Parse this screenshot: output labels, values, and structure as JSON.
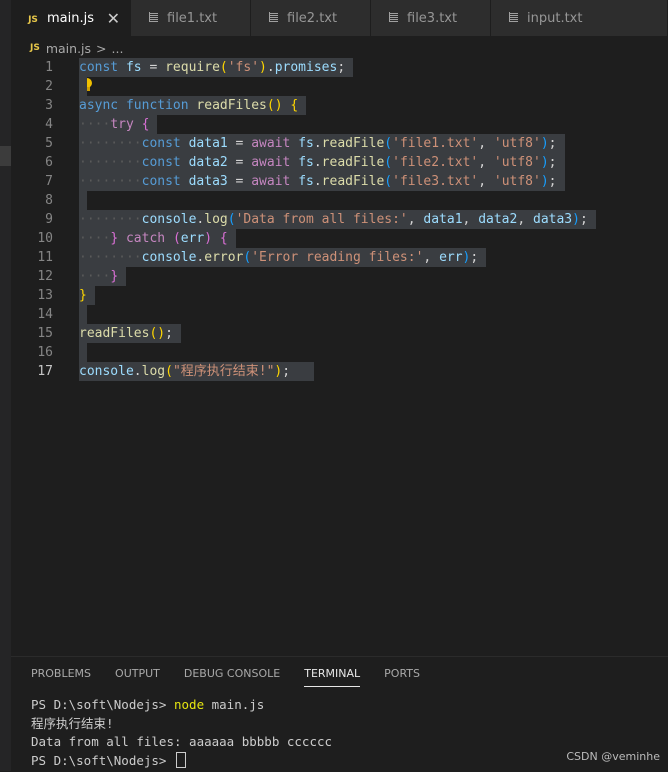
{
  "tabs": [
    {
      "label": "main.js",
      "icon": "js-icon",
      "active": true,
      "close": "✕"
    },
    {
      "label": "file1.txt",
      "icon": "file-lines-icon"
    },
    {
      "label": "file2.txt",
      "icon": "file-lines-icon"
    },
    {
      "label": "file3.txt",
      "icon": "file-lines-icon"
    },
    {
      "label": "input.txt",
      "icon": "file-lines-icon"
    }
  ],
  "breadcrumb": {
    "badge": "JS",
    "file": "main.js",
    "sep": ">",
    "more": "..."
  },
  "editor": {
    "current_line": 17,
    "lines": [
      {
        "n": "1",
        "tokens": [
          [
            "kw",
            "const"
          ],
          [
            "pl",
            " "
          ],
          [
            "vr",
            "fs"
          ],
          [
            "pl",
            " = "
          ],
          [
            "fn",
            "require"
          ],
          [
            "br1",
            "("
          ],
          [
            "st",
            "'fs'"
          ],
          [
            "br1",
            ")"
          ],
          [
            "pl",
            "."
          ],
          [
            "vr",
            "promises"
          ],
          [
            "pl",
            ";"
          ]
        ]
      },
      {
        "n": "2",
        "tokens": []
      },
      {
        "n": "3",
        "tokens": [
          [
            "kw",
            "async"
          ],
          [
            "pl",
            " "
          ],
          [
            "kw",
            "function"
          ],
          [
            "pl",
            " "
          ],
          [
            "fn",
            "readFiles"
          ],
          [
            "br1",
            "()"
          ],
          [
            "pl",
            " "
          ],
          [
            "br1",
            "{"
          ]
        ]
      },
      {
        "n": "4",
        "tokens": [
          [
            "dots",
            "····"
          ],
          [
            "ctl",
            "try"
          ],
          [
            "pl",
            " "
          ],
          [
            "br2",
            "{"
          ]
        ]
      },
      {
        "n": "5",
        "tokens": [
          [
            "dots",
            "········"
          ],
          [
            "kw",
            "const"
          ],
          [
            "pl",
            " "
          ],
          [
            "vr",
            "data1"
          ],
          [
            "pl",
            " = "
          ],
          [
            "ctl",
            "await"
          ],
          [
            "pl",
            " "
          ],
          [
            "vr",
            "fs"
          ],
          [
            "pl",
            "."
          ],
          [
            "fn",
            "readFile"
          ],
          [
            "br3",
            "("
          ],
          [
            "st",
            "'file1.txt'"
          ],
          [
            "pl",
            ", "
          ],
          [
            "st",
            "'utf8'"
          ],
          [
            "br3",
            ")"
          ],
          [
            "pl",
            ";"
          ]
        ]
      },
      {
        "n": "6",
        "tokens": [
          [
            "dots",
            "········"
          ],
          [
            "kw",
            "const"
          ],
          [
            "pl",
            " "
          ],
          [
            "vr",
            "data2"
          ],
          [
            "pl",
            " = "
          ],
          [
            "ctl",
            "await"
          ],
          [
            "pl",
            " "
          ],
          [
            "vr",
            "fs"
          ],
          [
            "pl",
            "."
          ],
          [
            "fn",
            "readFile"
          ],
          [
            "br3",
            "("
          ],
          [
            "st",
            "'file2.txt'"
          ],
          [
            "pl",
            ", "
          ],
          [
            "st",
            "'utf8'"
          ],
          [
            "br3",
            ")"
          ],
          [
            "pl",
            ";"
          ]
        ]
      },
      {
        "n": "7",
        "tokens": [
          [
            "dots",
            "········"
          ],
          [
            "kw",
            "const"
          ],
          [
            "pl",
            " "
          ],
          [
            "vr",
            "data3"
          ],
          [
            "pl",
            " = "
          ],
          [
            "ctl",
            "await"
          ],
          [
            "pl",
            " "
          ],
          [
            "vr",
            "fs"
          ],
          [
            "pl",
            "."
          ],
          [
            "fn",
            "readFile"
          ],
          [
            "br3",
            "("
          ],
          [
            "st",
            "'file3.txt'"
          ],
          [
            "pl",
            ", "
          ],
          [
            "st",
            "'utf8'"
          ],
          [
            "br3",
            ")"
          ],
          [
            "pl",
            ";"
          ]
        ]
      },
      {
        "n": "8",
        "tokens": []
      },
      {
        "n": "9",
        "tokens": [
          [
            "dots",
            "········"
          ],
          [
            "vr",
            "console"
          ],
          [
            "pl",
            "."
          ],
          [
            "fn",
            "log"
          ],
          [
            "br3",
            "("
          ],
          [
            "st",
            "'Data from all files:'"
          ],
          [
            "pl",
            ", "
          ],
          [
            "vr",
            "data1"
          ],
          [
            "pl",
            ", "
          ],
          [
            "vr",
            "data2"
          ],
          [
            "pl",
            ", "
          ],
          [
            "vr",
            "data3"
          ],
          [
            "br3",
            ")"
          ],
          [
            "pl",
            ";"
          ]
        ]
      },
      {
        "n": "10",
        "tokens": [
          [
            "dots",
            "····"
          ],
          [
            "br2",
            "}"
          ],
          [
            "pl",
            " "
          ],
          [
            "ctl",
            "catch"
          ],
          [
            "pl",
            " "
          ],
          [
            "br2",
            "("
          ],
          [
            "vr",
            "err"
          ],
          [
            "br2",
            ")"
          ],
          [
            "pl",
            " "
          ],
          [
            "br2",
            "{"
          ]
        ]
      },
      {
        "n": "11",
        "tokens": [
          [
            "dots",
            "········"
          ],
          [
            "vr",
            "console"
          ],
          [
            "pl",
            "."
          ],
          [
            "fn",
            "error"
          ],
          [
            "br3",
            "("
          ],
          [
            "st",
            "'Error reading files:'"
          ],
          [
            "pl",
            ", "
          ],
          [
            "vr",
            "err"
          ],
          [
            "br3",
            ")"
          ],
          [
            "pl",
            ";"
          ]
        ]
      },
      {
        "n": "12",
        "tokens": [
          [
            "dots",
            "····"
          ],
          [
            "br2",
            "}"
          ]
        ]
      },
      {
        "n": "13",
        "tokens": [
          [
            "br1",
            "}"
          ]
        ]
      },
      {
        "n": "14",
        "tokens": []
      },
      {
        "n": "15",
        "tokens": [
          [
            "fn",
            "readFiles"
          ],
          [
            "br1",
            "()"
          ],
          [
            "pl",
            ";"
          ]
        ]
      },
      {
        "n": "16",
        "tokens": []
      },
      {
        "n": "17",
        "tokens": [
          [
            "vr",
            "console"
          ],
          [
            "pl",
            "."
          ],
          [
            "fn",
            "log"
          ],
          [
            "br1",
            "("
          ],
          [
            "st",
            "\"程序执行结束!\""
          ],
          [
            "br1",
            ")"
          ],
          [
            "pl",
            ";"
          ]
        ]
      }
    ]
  },
  "panel": {
    "tabs": [
      "PROBLEMS",
      "OUTPUT",
      "DEBUG CONSOLE",
      "TERMINAL",
      "PORTS"
    ],
    "active_tab": "TERMINAL",
    "terminal": {
      "prompt1": "PS D:\\soft\\Nodejs> ",
      "cmd_name": "node",
      "cmd_arg": " main.js",
      "out1": "程序执行结束!",
      "out2": "Data from all files: aaaaaa bbbbb cccccc",
      "prompt2": "PS D:\\soft\\Nodejs> "
    }
  },
  "watermark": "CSDN @veminhe"
}
